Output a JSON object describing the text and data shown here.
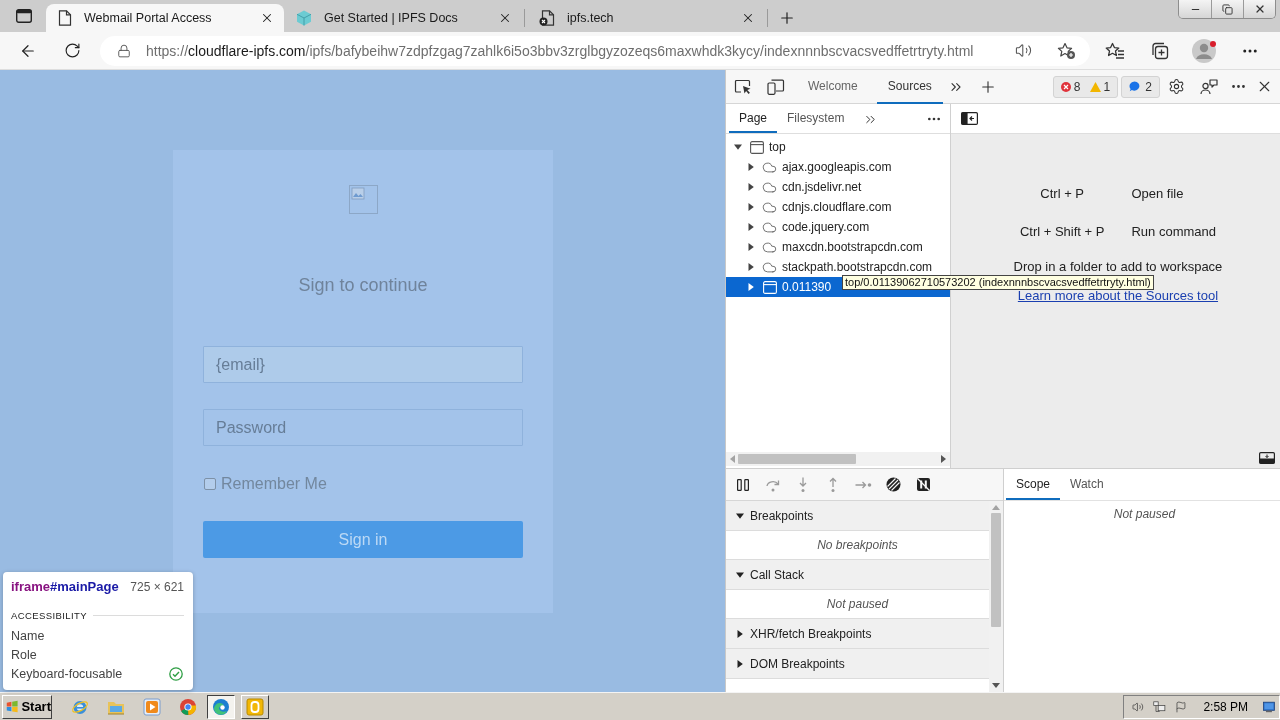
{
  "browser": {
    "tabs": [
      {
        "title": "Webmail Portal Access",
        "kind": "page",
        "selected": true
      },
      {
        "title": "Get Started | IPFS Docs",
        "kind": "cube",
        "selected": false
      },
      {
        "title": "ipfs.tech",
        "kind": "page-error",
        "selected": false
      }
    ],
    "address": {
      "scheme": "https://",
      "host": "cloudflare-ipfs.com",
      "path": "/ipfs/bafybeihw7zdpfzgag7zahlk6i5o3bbv3zrglbgyzozeqs6maxwhdk3kycy/indexnnnbscvacsvedffetrtryty.html"
    }
  },
  "page": {
    "heading": "Sign to continue",
    "fields": [
      {
        "kind": "email",
        "value": "{email}"
      },
      {
        "kind": "password",
        "placeholder": "Password"
      }
    ],
    "remember": {
      "label": "Remember Me",
      "checked": false
    },
    "submit": "Sign in"
  },
  "inspector": {
    "tag": "iframe",
    "id": "#mainPage",
    "size": "725 × 621",
    "section": "ACCESSIBILITY",
    "properties": [
      {
        "name": "Name",
        "checked": false
      },
      {
        "name": "Role",
        "checked": false
      },
      {
        "name": "Keyboard-focusable",
        "checked": true
      }
    ]
  },
  "devtools": {
    "tabs": [
      {
        "label": "Welcome",
        "selected": false
      },
      {
        "label": "Sources",
        "selected": true
      }
    ],
    "console_counts": [
      {
        "kind": "error",
        "count": "8"
      },
      {
        "kind": "warning",
        "count": "1"
      }
    ],
    "issues_count": "2",
    "navigator": {
      "tabs": [
        {
          "label": "Page",
          "selected": true
        },
        {
          "label": "Filesystem",
          "selected": false
        }
      ],
      "tree": [
        {
          "label": "top",
          "kind": "frame",
          "expanded": true,
          "selected": false,
          "children": [
            {
              "label": "ajax.googleapis.com",
              "kind": "domain",
              "expanded": false,
              "selected": false
            },
            {
              "label": "cdn.jsdelivr.net",
              "kind": "domain",
              "expanded": false,
              "selected": false
            },
            {
              "label": "cdnjs.cloudflare.com",
              "kind": "domain",
              "expanded": false,
              "selected": false
            },
            {
              "label": "code.jquery.com",
              "kind": "domain",
              "expanded": false,
              "selected": false
            },
            {
              "label": "maxcdn.bootstrapcdn.com",
              "kind": "domain",
              "expanded": false,
              "selected": false
            },
            {
              "label": "stackpath.bootstrapcdn.com",
              "kind": "domain",
              "expanded": false,
              "selected": false
            },
            {
              "label": "0.011390",
              "kind": "frame",
              "expanded": false,
              "selected": true
            }
          ]
        }
      ]
    },
    "tooltip": "top/0.01139062710573202 (indexnnnbscvacsvedffetrtryty.html)",
    "editor": {
      "shortcuts": [
        {
          "keys": "Ctrl + P",
          "action": "Open file"
        },
        {
          "keys": "Ctrl + Shift + P",
          "action": "Run command"
        }
      ],
      "drop_hint": "Drop in a folder to add to workspace",
      "link": "Learn more about the Sources tool"
    },
    "debugger": {
      "sections": [
        {
          "title": "Breakpoints",
          "expanded": true,
          "message": "No breakpoints"
        },
        {
          "title": "Call Stack",
          "expanded": true,
          "message": "Not paused"
        },
        {
          "title": "XHR/fetch Breakpoints",
          "expanded": false
        },
        {
          "title": "DOM Breakpoints",
          "expanded": false
        }
      ],
      "side_tabs": [
        {
          "label": "Scope",
          "selected": true
        },
        {
          "label": "Watch",
          "selected": false
        }
      ],
      "side_message": "Not paused"
    }
  },
  "taskbar": {
    "start": "Start",
    "quick_launch": [
      {
        "kind": "ie"
      },
      {
        "kind": "explorer"
      },
      {
        "kind": "media"
      },
      {
        "kind": "chrome"
      }
    ],
    "windows": [
      {
        "kind": "edge",
        "selected": true
      },
      {
        "kind": "app",
        "selected": false
      }
    ],
    "clock": "2:58 PM"
  }
}
